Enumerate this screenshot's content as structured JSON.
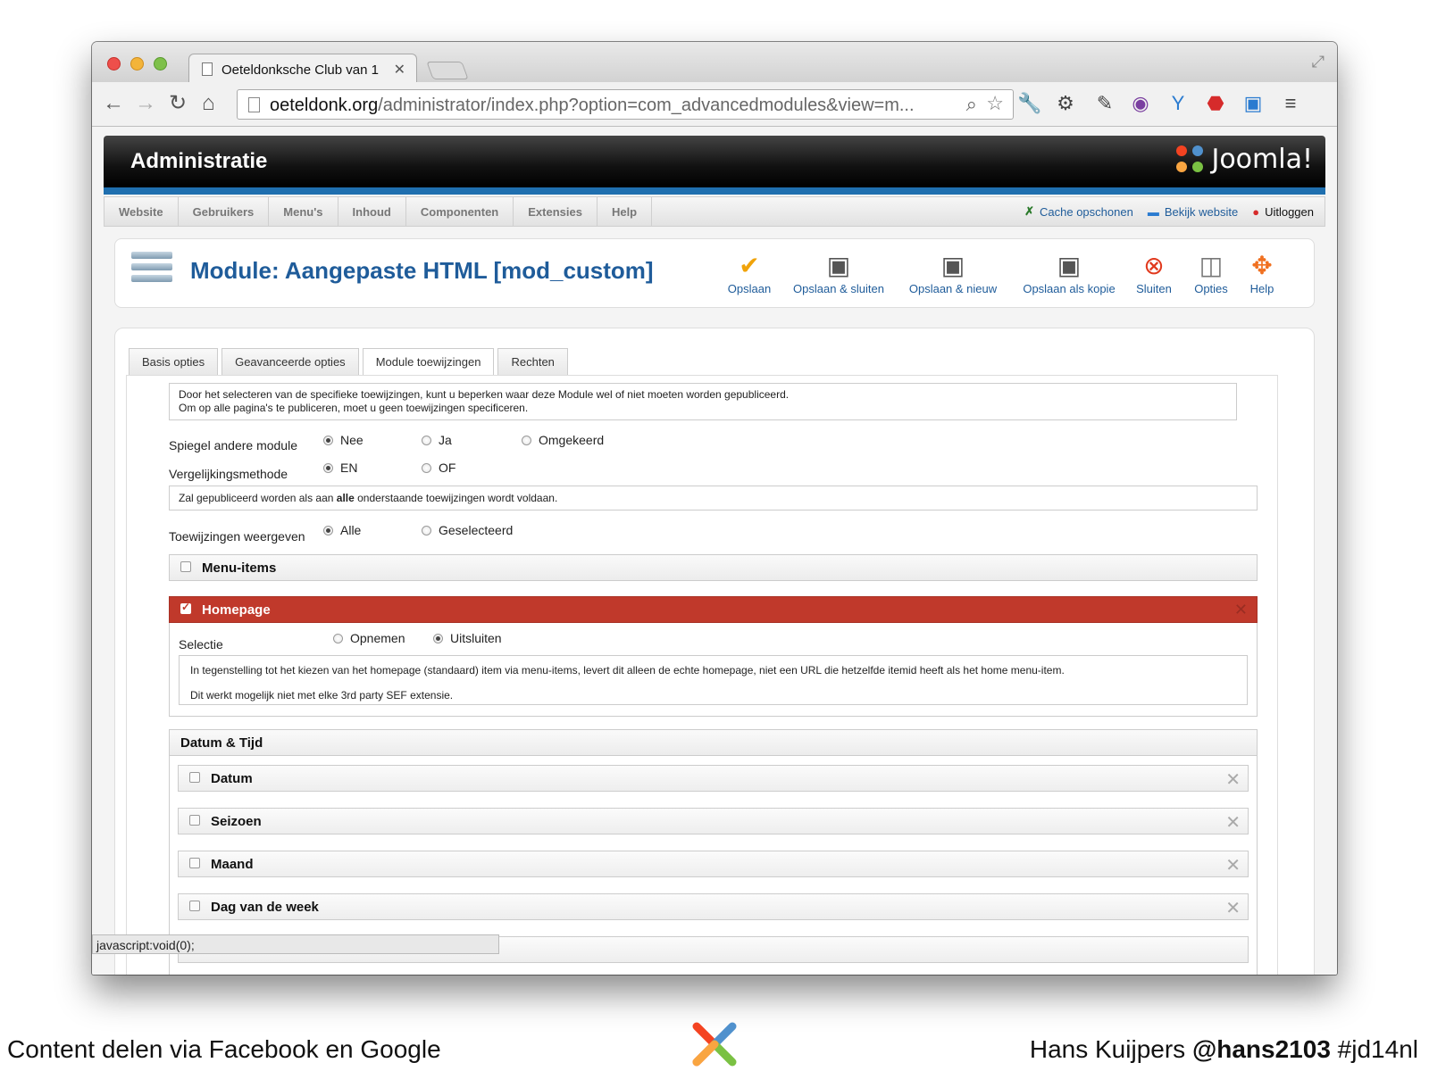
{
  "browser": {
    "tab_title": "Oeteldonksche Club van 1",
    "url_host": "oeteldonk.org",
    "url_path": "/administrator/index.php?option=com_advancedmodules&view=m..."
  },
  "joomla": {
    "admin_title": "Administratie",
    "logo_text": "Joomla!",
    "menu": [
      "Website",
      "Gebruikers",
      "Menu's",
      "Inhoud",
      "Componenten",
      "Extensies",
      "Help"
    ],
    "status": {
      "cache": "Cache opschonen",
      "view_site": "Bekijk website",
      "logout": "Uitloggen"
    }
  },
  "page": {
    "title": "Module: Aangepaste HTML [mod_custom]",
    "toolbar": {
      "save": "Opslaan",
      "save_close": "Opslaan & sluiten",
      "save_new": "Opslaan & nieuw",
      "save_copy": "Opslaan als kopie",
      "close": "Sluiten",
      "options": "Opties",
      "help": "Help"
    }
  },
  "tabs": [
    "Basis opties",
    "Geavanceerde opties",
    "Module toewijzingen",
    "Rechten"
  ],
  "form": {
    "intro_line1": "Door het selecteren van de specifieke toewijzingen, kunt u beperken waar deze Module wel of niet moeten worden gepubliceerd.",
    "intro_line2": "Om op alle pagina's te publiceren, moet u geen toewijzingen specificeren.",
    "mirror_label": "Spiegel andere module",
    "mirror_options": [
      "Nee",
      "Ja",
      "Omgekeerd"
    ],
    "mirror_selected": "Nee",
    "compare_label": "Vergelijkingsmethode",
    "compare_options": [
      "EN",
      "OF"
    ],
    "compare_selected": "EN",
    "compare_note_pre": "Zal gepubliceerd worden als aan ",
    "compare_note_bold": "alle",
    "compare_note_post": " onderstaande toewijzingen wordt voldaan.",
    "show_label": "Toewijzingen weergeven",
    "show_options": [
      "Alle",
      "Geselecteerd"
    ],
    "show_selected": "Alle",
    "menu_items": "Menu-items",
    "homepage": "Homepage",
    "selection_label": "Selectie",
    "selection_options": [
      "Opnemen",
      "Uitsluiten"
    ],
    "selection_selected": "Uitsluiten",
    "homepage_note1": "In tegenstelling tot het kiezen van het homepage (standaard) item via menu-items, levert dit alleen de echte homepage, niet een URL die hetzelfde itemid heeft als het home menu-item.",
    "homepage_note2": "Dit werkt mogelijk niet met elke 3rd party SEF extensie.",
    "date_section": "Datum & Tijd",
    "date_items": [
      "Datum",
      "Seizoen",
      "Maand",
      "Dag van de week"
    ]
  },
  "statusbar_text": "javascript:void(0);",
  "footer": {
    "left": "Content delen via Facebook en Google",
    "right_name": "Hans Kuijpers ",
    "right_handle": "@hans2103",
    "right_tag": " #jd14nl"
  },
  "colors": {
    "joomla_blue": "#1f5c9a",
    "homepage_red": "#c0392b",
    "header_stripe": "#1f6faf"
  }
}
